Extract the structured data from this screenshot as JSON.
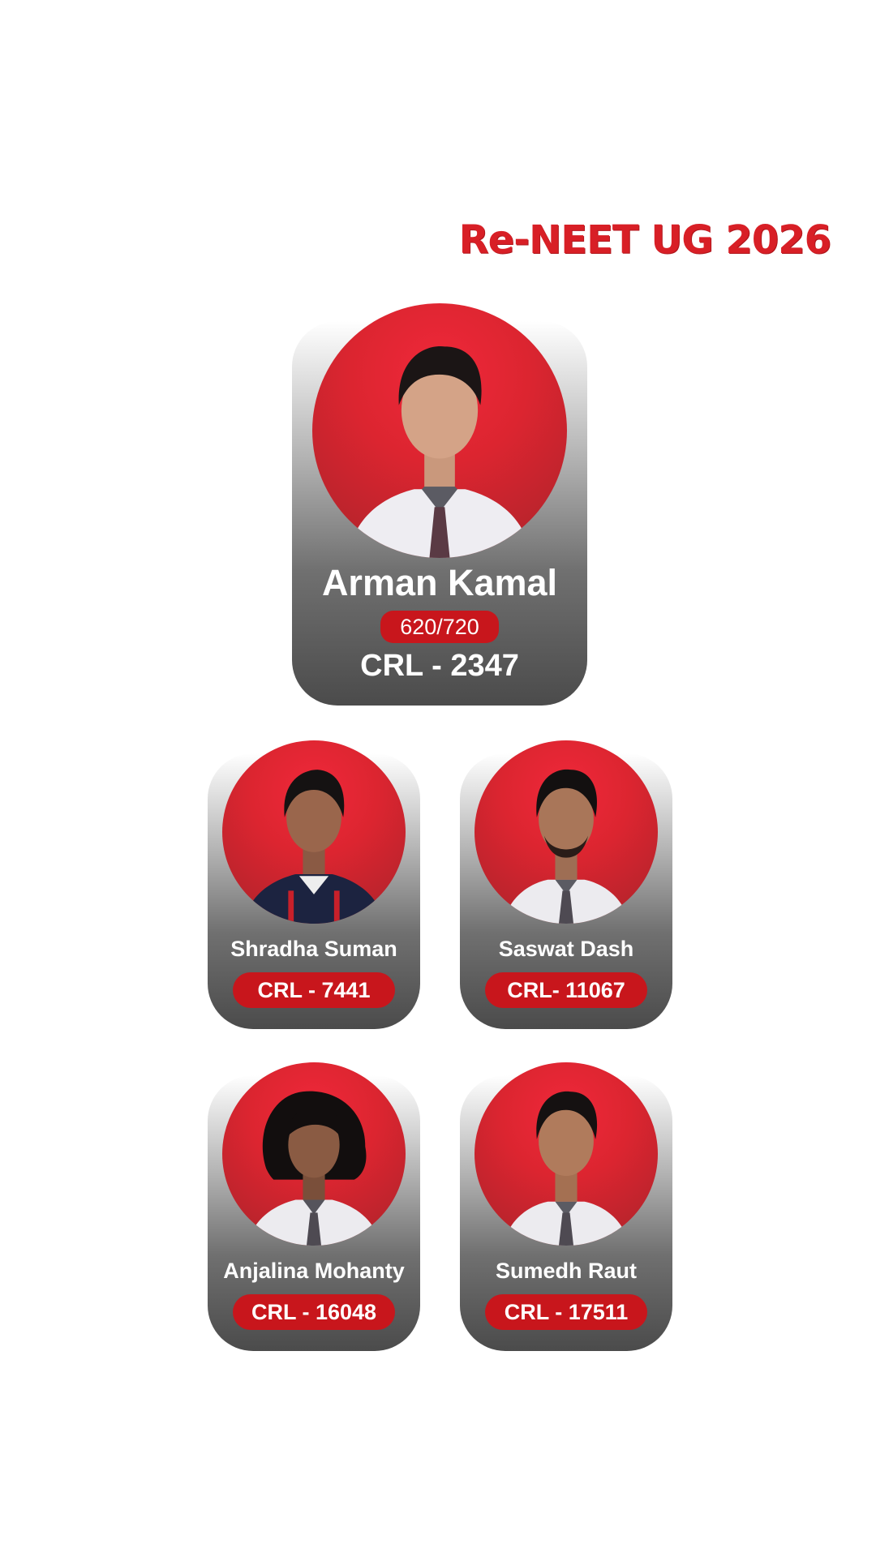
{
  "header": {
    "title": "Re-NEET UG 2026",
    "accent_color": "#d81f26"
  },
  "topper": {
    "name": "Arman Kamal",
    "score": "620/720",
    "rank": "CRL - 2347",
    "icon": "student-photo"
  },
  "students": [
    {
      "name": "Shradha Suman",
      "rank": "CRL - 7441",
      "icon": "student-photo"
    },
    {
      "name": "Saswat Dash",
      "rank": "CRL- 11067",
      "icon": "student-photo"
    },
    {
      "name": "Anjalina Mohanty",
      "rank": "CRL - 16048",
      "icon": "student-photo"
    },
    {
      "name": "Sumedh Raut",
      "rank": "CRL - 17511",
      "icon": "student-photo"
    }
  ],
  "colors": {
    "badge": "#c8161c",
    "photo_bg": "#dc2530",
    "card_bottom": "#4b4b4b"
  }
}
